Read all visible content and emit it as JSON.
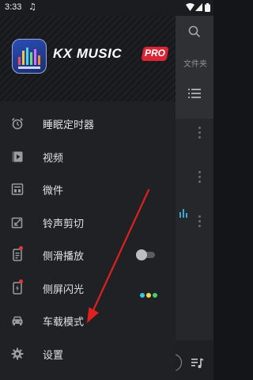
{
  "status_bar": {
    "time": "3:33",
    "note_glyph": "♫"
  },
  "header": {
    "app_name": "KX MUSIC",
    "badge": "PRO"
  },
  "menu": {
    "items": [
      {
        "label": "睡眠定时器",
        "icon": "alarm-clock-icon"
      },
      {
        "label": "视频",
        "icon": "video-icon"
      },
      {
        "label": "微件",
        "icon": "widget-icon"
      },
      {
        "label": "铃声剪切",
        "icon": "ringtone-cut-icon"
      },
      {
        "label": "侧滑播放",
        "icon": "side-swipe-icon",
        "toggle": "off",
        "new_dot": true
      },
      {
        "label": "侧屏闪光",
        "icon": "edge-flash-icon",
        "new_dot": true
      },
      {
        "label": "车载模式",
        "icon": "car-icon"
      },
      {
        "label": "设置",
        "icon": "gear-icon"
      }
    ]
  },
  "flash_colors": [
    "#35c7e8",
    "#f0d84a",
    "#43d16a"
  ],
  "background_app": {
    "folder_tab": "文件夹"
  },
  "colors": {
    "accent_red": "#d92534",
    "annotation_arrow": "#e0201e"
  }
}
